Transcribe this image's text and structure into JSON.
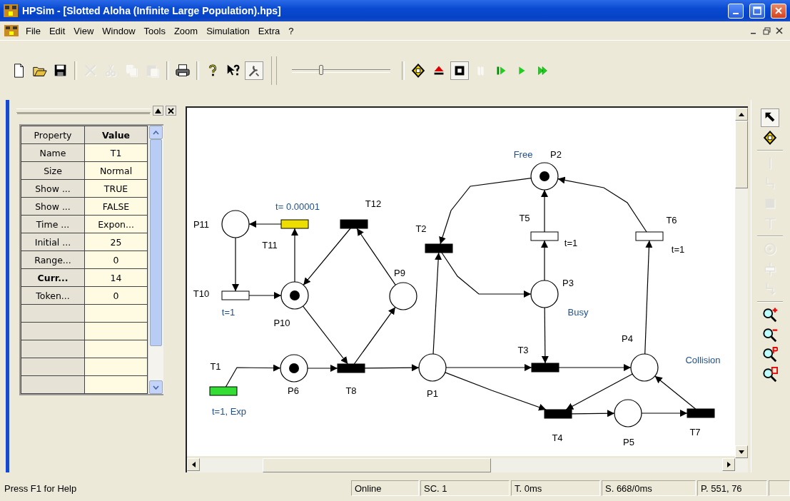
{
  "window": {
    "title": "HPSim - [Slotted Aloha (Infinite Large Population).hps]"
  },
  "menu": [
    "File",
    "Edit",
    "View",
    "Window",
    "Tools",
    "Zoom",
    "Simulation",
    "Extra",
    "?"
  ],
  "toolbar": [
    {
      "kind": "new",
      "disabled": false,
      "pressed": false
    },
    {
      "kind": "open",
      "disabled": false,
      "pressed": false
    },
    {
      "kind": "save",
      "disabled": false,
      "pressed": false
    },
    {
      "kind": "sep"
    },
    {
      "kind": "delete",
      "disabled": true,
      "pressed": false
    },
    {
      "kind": "cut",
      "disabled": true,
      "pressed": false
    },
    {
      "kind": "copy",
      "disabled": true,
      "pressed": false
    },
    {
      "kind": "paste",
      "disabled": true,
      "pressed": false
    },
    {
      "kind": "sep"
    },
    {
      "kind": "print",
      "disabled": false,
      "pressed": false
    },
    {
      "kind": "sep"
    },
    {
      "kind": "help",
      "disabled": false,
      "pressed": false
    },
    {
      "kind": "context-help",
      "disabled": false,
      "pressed": false
    },
    {
      "kind": "wrench",
      "disabled": false,
      "pressed": true
    },
    {
      "kind": "bigsep"
    },
    {
      "kind": "slider",
      "level": 0.3
    },
    {
      "kind": "sep"
    },
    {
      "kind": "move",
      "disabled": false,
      "pressed": false
    },
    {
      "kind": "eject",
      "disabled": false,
      "pressed": false
    },
    {
      "kind": "stop",
      "disabled": false,
      "pressed": true
    },
    {
      "kind": "pause",
      "disabled": true,
      "pressed": false
    },
    {
      "kind": "step",
      "disabled": false,
      "pressed": false
    },
    {
      "kind": "play",
      "disabled": false,
      "pressed": false
    },
    {
      "kind": "fast",
      "disabled": false,
      "pressed": false
    }
  ],
  "properties": {
    "columns": [
      "Property",
      "Value"
    ],
    "rows": [
      {
        "name": "Name",
        "value": "T1",
        "bold": false
      },
      {
        "name": "Size",
        "value": "Normal",
        "bold": false
      },
      {
        "name": "Show ...",
        "value": "TRUE",
        "bold": false
      },
      {
        "name": "Show ...",
        "value": "FALSE",
        "bold": false
      },
      {
        "name": "Time ...",
        "value": "Expon...",
        "bold": false
      },
      {
        "name": "Initial ...",
        "value": "25",
        "bold": false
      },
      {
        "name": "Range...",
        "value": "0",
        "bold": false
      },
      {
        "name": "Curr...",
        "value": "14",
        "bold": true
      },
      {
        "name": "Token...",
        "value": "0",
        "bold": false
      }
    ]
  },
  "net": {
    "places": [
      {
        "name": "P1",
        "marked": false
      },
      {
        "name": "P2",
        "marked": true,
        "note": "Free"
      },
      {
        "name": "P3",
        "marked": false,
        "note": "Busy"
      },
      {
        "name": "P4",
        "marked": false,
        "note": "Collision"
      },
      {
        "name": "P5",
        "marked": false
      },
      {
        "name": "P6",
        "marked": true
      },
      {
        "name": "P9",
        "marked": false
      },
      {
        "name": "P10",
        "marked": true
      },
      {
        "name": "P11",
        "marked": false
      }
    ],
    "transitions": [
      {
        "name": "T1",
        "color": "#33dd33",
        "delay": {
          "text": "t=1, Exp",
          "color": "#1f4f8f"
        }
      },
      {
        "name": "T2",
        "color": "#000000"
      },
      {
        "name": "T3",
        "color": "#000000"
      },
      {
        "name": "T4",
        "color": "#000000"
      },
      {
        "name": "T5",
        "color": "#ffffff",
        "delay": {
          "text": "t=1",
          "color": "#000000"
        }
      },
      {
        "name": "T6",
        "color": "#ffffff",
        "delay": {
          "text": "t=1",
          "color": "#000000"
        }
      },
      {
        "name": "T7",
        "color": "#000000"
      },
      {
        "name": "T8",
        "color": "#000000"
      },
      {
        "name": "T10",
        "color": "#ffffff",
        "delay": {
          "text": "t=1",
          "color": "#1f4f8f"
        }
      },
      {
        "name": "T11",
        "color": "#eedd00",
        "delay": {
          "text": "t= 0.00001",
          "color": "#1f4f8f"
        }
      },
      {
        "name": "T12",
        "color": "#000000"
      }
    ]
  },
  "tools": [
    {
      "kind": "pointer",
      "disabled": false,
      "pressed": true
    },
    {
      "kind": "move",
      "disabled": false,
      "pressed": false
    },
    {
      "kind": "line",
      "disabled": true,
      "pressed": false
    },
    {
      "kind": "bend",
      "disabled": true,
      "pressed": false
    },
    {
      "kind": "square",
      "disabled": true,
      "pressed": false
    },
    {
      "kind": "text",
      "disabled": true,
      "pressed": false
    },
    {
      "kind": "place",
      "disabled": true,
      "pressed": false
    },
    {
      "kind": "transition",
      "disabled": true,
      "pressed": false
    },
    {
      "kind": "arc",
      "disabled": true,
      "pressed": false
    },
    {
      "kind": "zoom-in",
      "disabled": false,
      "pressed": false
    },
    {
      "kind": "zoom-out",
      "disabled": false,
      "pressed": false
    },
    {
      "kind": "zoom-page",
      "disabled": false,
      "pressed": false
    },
    {
      "kind": "zoom-fit",
      "disabled": false,
      "pressed": false
    }
  ],
  "status_bar": {
    "help": "Press F1 for Help",
    "panels": [
      "Online",
      "SC. 1",
      "T. 0ms",
      "S. 668/0ms",
      "P. 551, 76"
    ]
  }
}
